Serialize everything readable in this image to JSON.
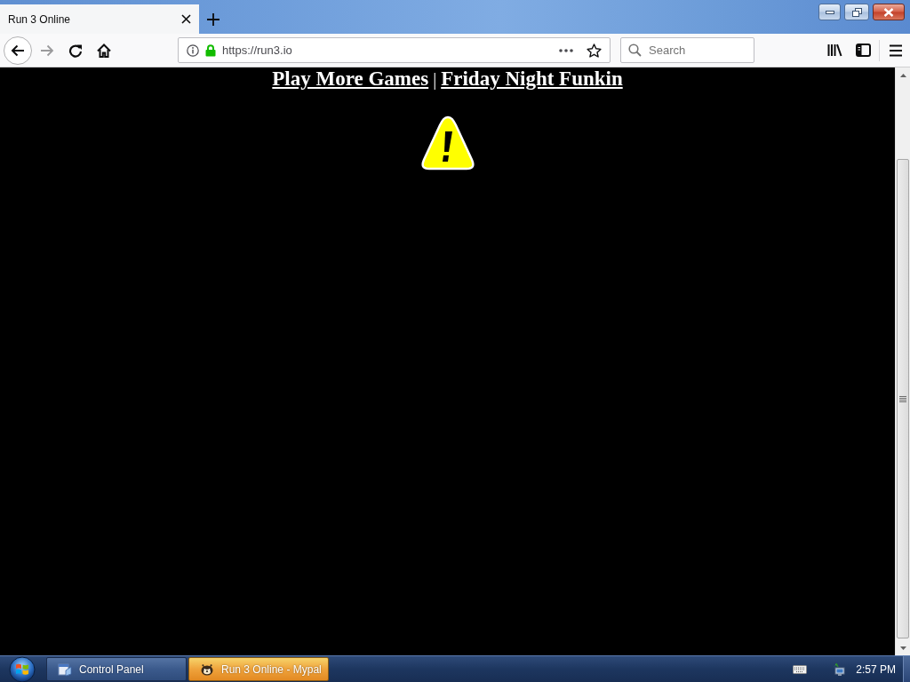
{
  "browser": {
    "tabs": [
      {
        "title": "Run 3 Online",
        "selected": true
      }
    ],
    "navigation": {
      "forward_disabled": true
    },
    "address_bar": {
      "url": "https://run3.io"
    },
    "search": {
      "placeholder": "Search"
    }
  },
  "page": {
    "links": [
      "Play More Games",
      "Friday Night Funkin"
    ],
    "separator": "|"
  },
  "taskbar": {
    "items": [
      {
        "label": "Control Panel",
        "kind": "panel",
        "selected": false
      },
      {
        "label": "Run 3 Online - Mypal",
        "kind": "browser",
        "selected": true
      }
    ],
    "clock": "2:57 PM"
  }
}
